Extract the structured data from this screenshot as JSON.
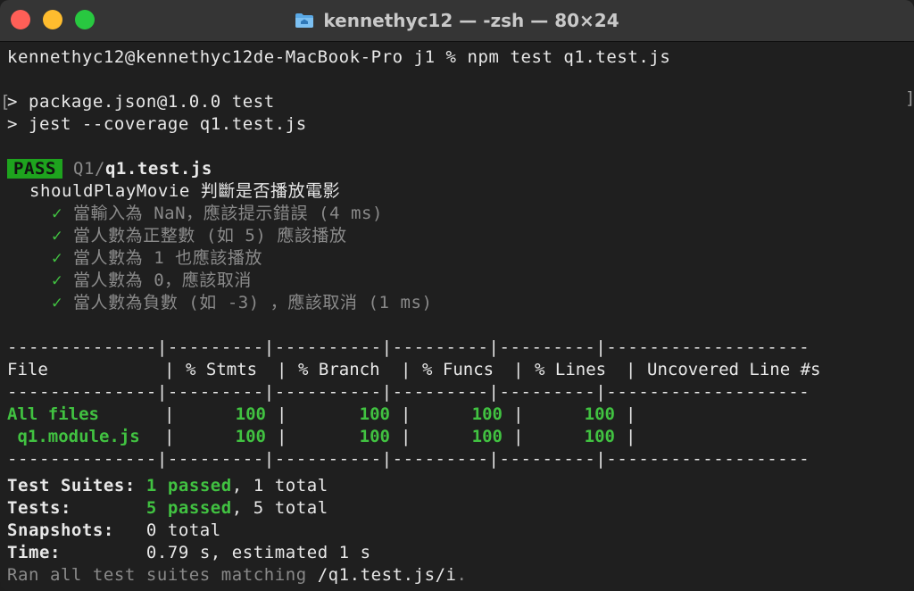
{
  "window": {
    "title": "kennethyc12 — -zsh — 80×24"
  },
  "terminal": {
    "prompt_line": "kennethyc12@kennethyc12de-MacBook-Pro j1 % npm test q1.test.js",
    "script_line_1": "> package.json@1.0.0 test",
    "script_line_2": "> jest --coverage q1.test.js",
    "pass_badge": "PASS",
    "test_dir": "Q1/",
    "test_file": "q1.test.js",
    "describe_block": "shouldPlayMovie 判斷是否播放電影",
    "check_glyph": "✓",
    "tests": [
      "當輸入為 NaN，應該提示錯誤 (4 ms)",
      "當人數為正整數 (如 5) 應該播放",
      "當人數為 1 也應該播放",
      "當人數為 0，應該取消",
      "當人數為負數 (如 -3) ，應該取消 (1 ms)"
    ],
    "coverage": {
      "separator": "--------------|---------|----------|---------|---------|-------------------",
      "headers": [
        "File",
        "% Stmts",
        "% Branch",
        "% Funcs",
        "% Lines",
        "Uncovered Line #s"
      ],
      "rows": [
        {
          "file": "All files",
          "stmts": "100",
          "branch": "100",
          "funcs": "100",
          "lines": "100",
          "uncovered": ""
        },
        {
          "file": " q1.module.js",
          "stmts": "100",
          "branch": "100",
          "funcs": "100",
          "lines": "100",
          "uncovered": ""
        }
      ]
    },
    "summary": {
      "suites_label": "Test Suites:",
      "suites_passed": "1 passed",
      "suites_total": ", 1 total",
      "tests_label": "Tests:",
      "tests_passed": "5 passed",
      "tests_total": ", 5 total",
      "snapshots_label": "Snapshots:",
      "snapshots_value": "0 total",
      "time_label": "Time:",
      "time_value": "0.79 s, estimated 1 s",
      "ran_prefix": "Ran all test suites matching ",
      "ran_pattern": "/q1.test.js/i",
      "ran_suffix": "."
    }
  },
  "colors": {
    "pass_bg": "#1ea31e",
    "green": "#41c241",
    "background": "#1f1f1f"
  }
}
